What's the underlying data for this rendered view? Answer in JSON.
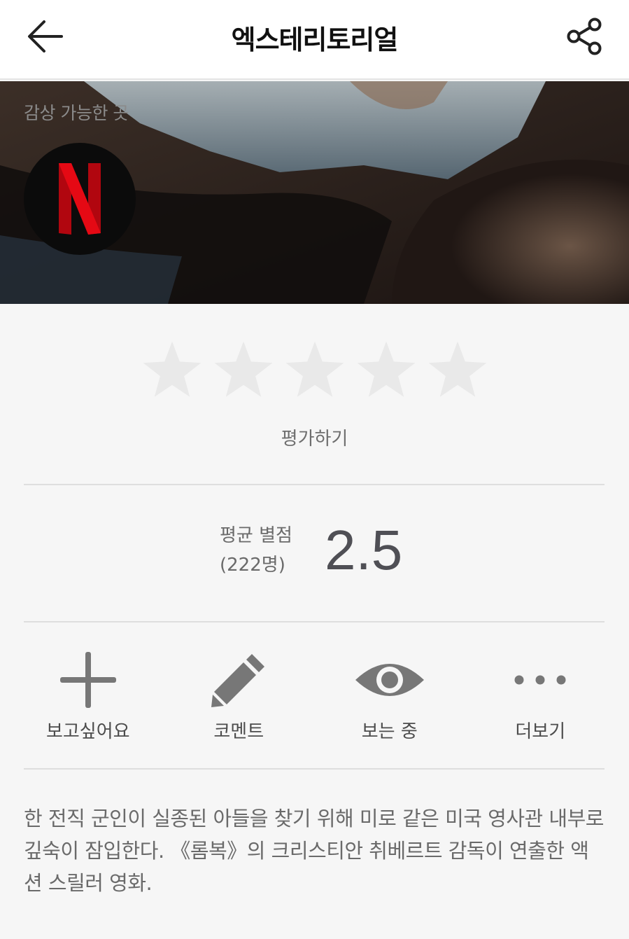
{
  "header": {
    "title": "엑스테리토리얼",
    "back_icon": "arrow-left-icon",
    "share_icon": "share-icon"
  },
  "hero": {
    "watch_label": "감상 가능한 곳",
    "provider_icon": "netflix-logo",
    "provider_color": "#e50914"
  },
  "rating": {
    "stars_total": 5,
    "stars_filled": 0,
    "label": "평가하기"
  },
  "average": {
    "label": "평균 별점",
    "count": "(222명)",
    "value": "2.5"
  },
  "actions": [
    {
      "label": "보고싶어요",
      "icon": "plus-icon"
    },
    {
      "label": "코멘트",
      "icon": "pencil-icon"
    },
    {
      "label": "보는 중",
      "icon": "eye-icon"
    },
    {
      "label": "더보기",
      "icon": "more-dots-icon"
    }
  ],
  "description": "한 전직 군인이 실종된 아들을 찾기 위해 미로 같은 미국 영사관 내부로 깊숙이 잠입한다. 《롬복》의 크리스티안 취베르트 감독이 연출한 액션 스릴러 영화."
}
